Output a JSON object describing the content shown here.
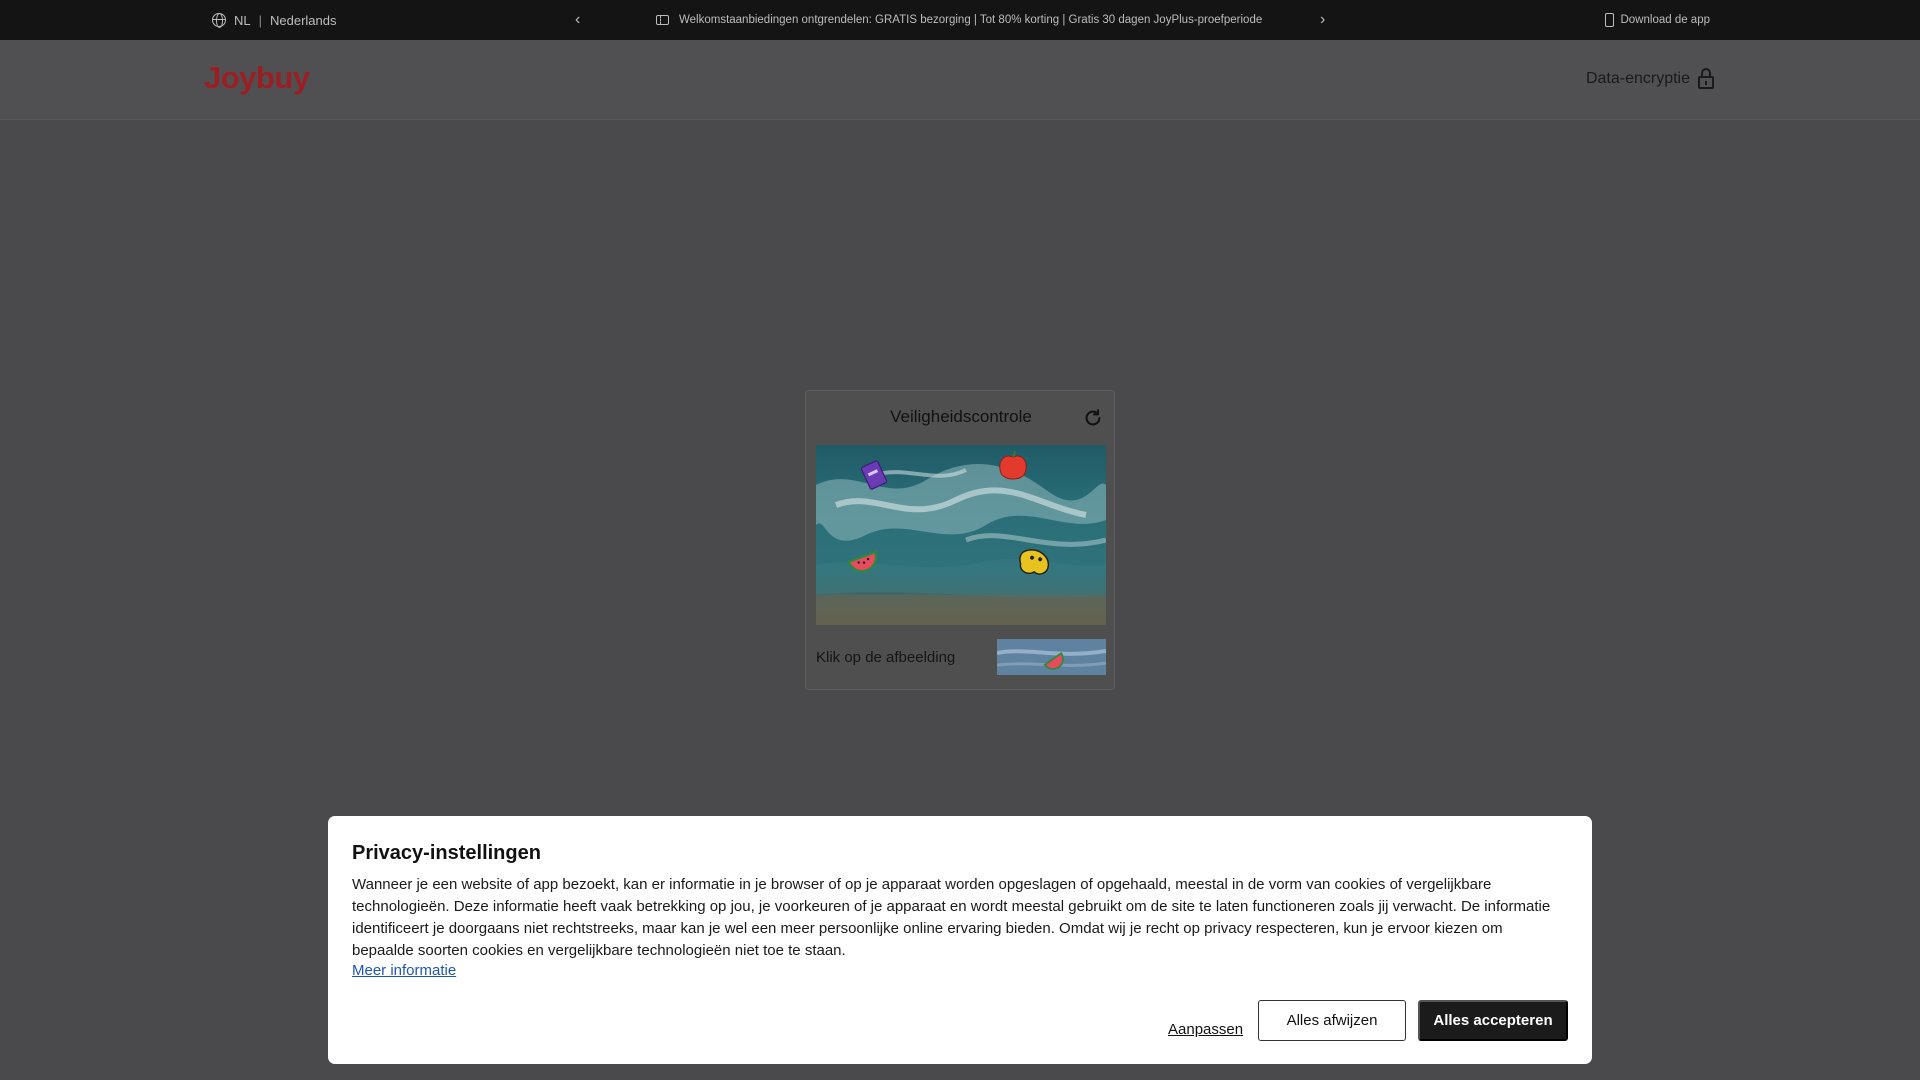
{
  "topbar": {
    "country": "NL",
    "separator": "|",
    "language": "Nederlands",
    "prev_arrow": "‹",
    "next_arrow": "›",
    "promo": "Welkomstaanbiedingen ontgrendelen: GRATIS bezorging | Tot 80% korting | Gratis 30 dagen JoyPlus-proefperiode",
    "download_app": "Download de app"
  },
  "header": {
    "logo": "Joybuy",
    "encryption_label": "Data-encryptie"
  },
  "captcha": {
    "title": "Veiligheidscontrole",
    "instruction": "Klik op de afbeelding"
  },
  "cookie": {
    "title": "Privacy-instellingen",
    "body": "Wanneer je een website of app bezoekt, kan er informatie in je browser of op je apparaat worden opgeslagen of opgehaald, meestal in de vorm van cookies of vergelijkbare technologieën. Deze informatie heeft vaak betrekking op jou, je voorkeuren of je apparaat en wordt meestal gebruikt om de site te laten functioneren zoals jij verwacht. De informatie identificeert je doorgaans niet rechtstreeks, maar kan je wel een meer persoonlijke online ervaring bieden. Omdat wij je recht op privacy respecteren, kun je ervoor kiezen om bepaalde soorten cookies en vergelijkbare technologieën niet toe te staan.",
    "more_info": "Meer informatie",
    "adjust": "Aanpassen",
    "reject_all": "Alles afwijzen",
    "accept_all": "Alles accepteren"
  },
  "colors": {
    "overlay": "#4a4a4c",
    "topbar": "#141414",
    "brand": "#9a1f24",
    "link": "#1f55b5",
    "accept_button": "#1b1b1b"
  }
}
